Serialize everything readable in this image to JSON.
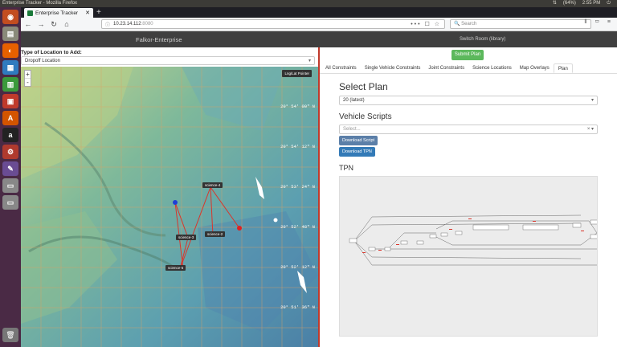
{
  "os": {
    "window_title": "Enterprise Tracker - Mozilla Firefox",
    "battery": "(64%)",
    "clock": "2:55 PM"
  },
  "browser": {
    "tab_title": "Enterprise Tracker",
    "url_host": "10.23.14.112",
    "url_port": ":8080",
    "url_actions": "••• ☐ ☆",
    "search_placeholder": "Search",
    "toolbar_icons": "⫴ ▭ ≡"
  },
  "app": {
    "title": "Falkor-Enterprise",
    "room": "Switch Room (library)"
  },
  "left": {
    "location_label": "Type of Location to Add:",
    "location_value": "Dropoff Location",
    "zoom_in": "+",
    "zoom_out": "-",
    "pointer_button": "Lng/Lat Pointer",
    "coords": [
      "20° 54' 00\" N",
      "20° 54' 12\" N",
      "20° 53' 24\" N",
      "20° 52' 48\" N",
      "20° 52' 12\" N",
      "20° 51' 36\" N"
    ],
    "markers": [
      "science-4",
      "science-3",
      "science-2",
      "science-5"
    ]
  },
  "right": {
    "submit_label": "Submit Plan",
    "tabs": [
      "All Constraints",
      "Single Vehicle Constraints",
      "Joint Constraints",
      "Science Locations",
      "Map Overlays",
      "Plan"
    ],
    "select_plan_heading": "Select Plan",
    "plan_value": "20 (latest)",
    "vehicle_scripts_heading": "Vehicle Scripts",
    "vehicle_placeholder": "Select...",
    "clear_symbol": "× ▾",
    "download_script": "Download Script",
    "download_tpn": "Download TPN",
    "tpn_heading": "TPN"
  },
  "colors": {
    "header": "#3f3f3f",
    "submit": "#5cb85c",
    "button_blue": "#337ab7",
    "divider": "#c0392b",
    "route": "#d9352b"
  }
}
